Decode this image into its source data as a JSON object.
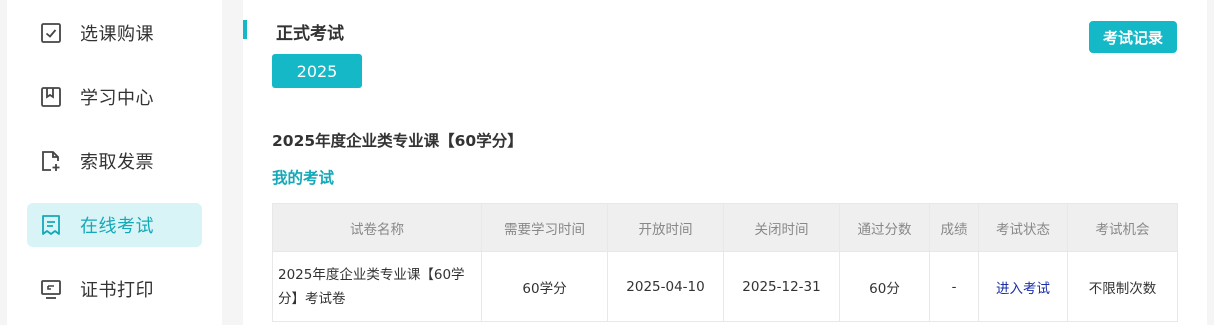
{
  "sidebar": {
    "items": [
      {
        "label": "选课购课",
        "icon": "checkbox-icon"
      },
      {
        "label": "学习中心",
        "icon": "bookmark-icon"
      },
      {
        "label": "索取发票",
        "icon": "add-document-icon"
      },
      {
        "label": "在线考试",
        "icon": "exam-paper-icon",
        "active": true
      },
      {
        "label": "证书打印",
        "icon": "monitor-certificate-icon"
      }
    ]
  },
  "main": {
    "title": "正式考试",
    "year_button": "2025",
    "record_button": "考试记录",
    "course_title": "2025年度企业类专业课【60学分】",
    "section_title": "我的考试"
  },
  "table": {
    "headers": [
      "试卷名称",
      "需要学习时间",
      "开放时间",
      "关闭时间",
      "通过分数",
      "成绩",
      "考试状态",
      "考试机会"
    ],
    "rows": [
      {
        "name": "2025年度企业类专业课【60学分】考试卷",
        "study_time": "60学分",
        "open_date": "2025-04-10",
        "close_date": "2025-12-31",
        "pass_score": "60分",
        "score": "-",
        "status": "进入考试",
        "chances": "不限制次数"
      }
    ]
  },
  "colors": {
    "accent": "#14b8c6",
    "active_bg": "#d9f4f6",
    "link": "#1a2fa8"
  }
}
